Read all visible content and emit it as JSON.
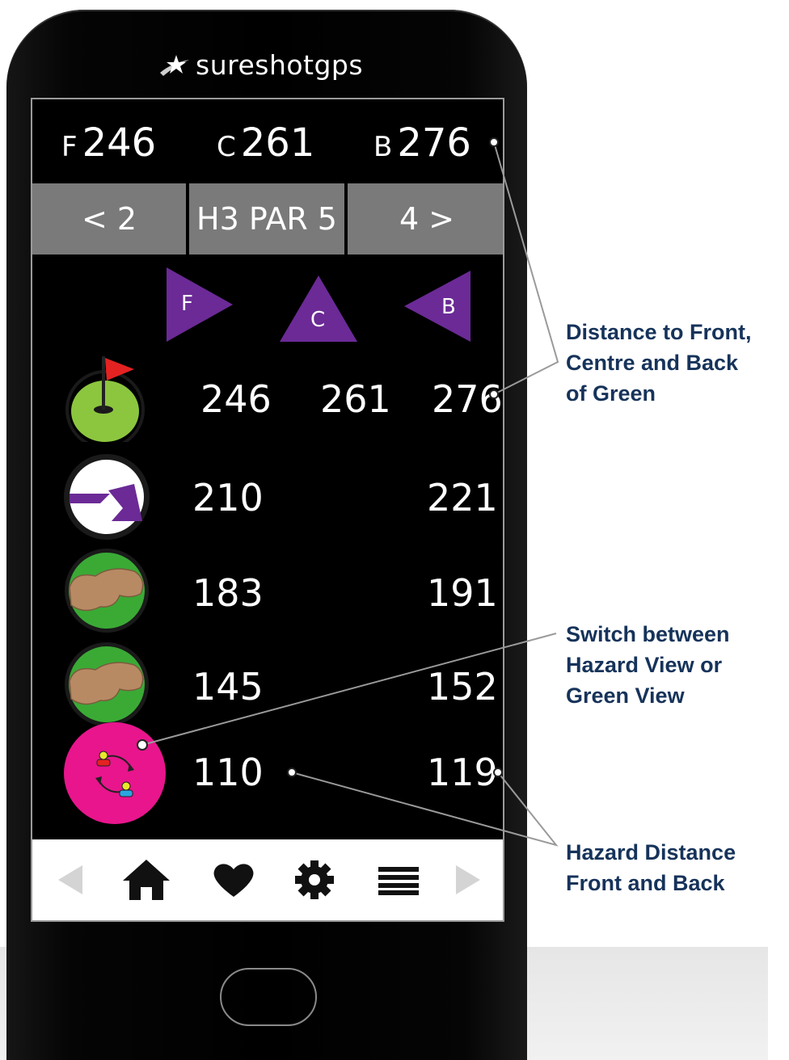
{
  "brand": {
    "name": "sureshotgps",
    "logo_icon": "star-swoosh-icon"
  },
  "green_distances": {
    "front": {
      "label": "F",
      "value": "246"
    },
    "centre": {
      "label": "C",
      "value": "261"
    },
    "back": {
      "label": "B",
      "value": "276"
    }
  },
  "hole_nav": {
    "prev_label": "< 2",
    "current_label": "H3 PAR 5",
    "next_label": "4 >"
  },
  "markers": {
    "front": "F",
    "centre": "C",
    "back": "B"
  },
  "rows": [
    {
      "icon": "green-flag-icon",
      "front": "246",
      "centre": "261",
      "back": "276"
    },
    {
      "icon": "dogleg-icon",
      "front": "210",
      "back": "221"
    },
    {
      "icon": "bunker-icon",
      "front": "183",
      "back": "191"
    },
    {
      "icon": "bunker-icon",
      "front": "145",
      "back": "152"
    },
    {
      "icon": "switch-view-icon",
      "front": "110",
      "back": "119"
    }
  ],
  "bottom_bar": {
    "items": [
      "left-arrow-icon",
      "home-icon",
      "heart-icon",
      "gear-icon",
      "menu-icon",
      "right-arrow-icon"
    ]
  },
  "callouts": {
    "green": [
      "Distance to Front,",
      "Centre and Back",
      "of Green"
    ],
    "switch": [
      "Switch between",
      "Hazard View or",
      "Green View"
    ],
    "hazard": [
      "Hazard Distance",
      "Front and Back"
    ]
  },
  "colors": {
    "marker_purple": "#6b2a96",
    "green_fill": "#8cc63f",
    "fairway_green": "#3aaa35",
    "bunker_sand": "#b88a64",
    "switch_pink": "#e8158c",
    "nav_gray": "#7a7a7a",
    "callout_text": "#16335a"
  }
}
